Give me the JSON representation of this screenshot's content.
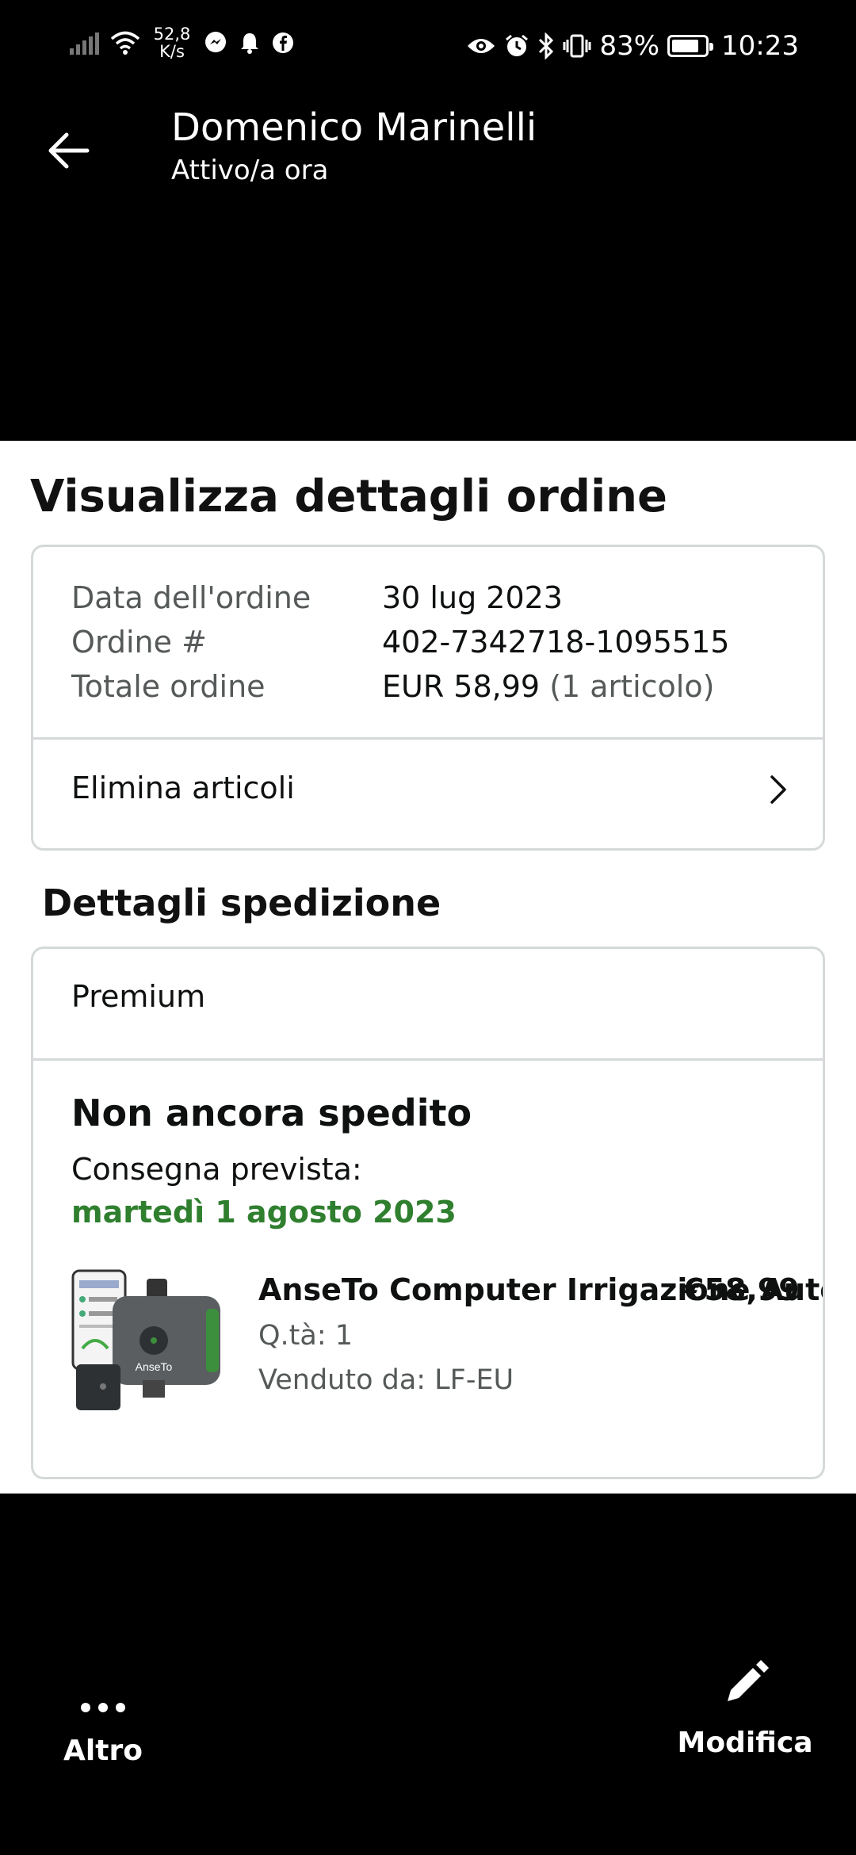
{
  "status_bar": {
    "net_speed": "52,8\nK/s",
    "battery": "83%",
    "battery_level": 0.83,
    "time": "10:23",
    "icons": [
      "signal-icon",
      "wifi-icon",
      "messenger-icon",
      "bell-icon",
      "facebook-icon",
      "eye-icon",
      "alarm-icon",
      "bluetooth-icon",
      "vibrate-icon",
      "battery-icon"
    ]
  },
  "header": {
    "contact_name": "Domenico Marinelli",
    "contact_status": "Attivo/a ora"
  },
  "order": {
    "page_title": "Visualizza dettagli ordine",
    "rows": [
      {
        "label": "Data dell'ordine",
        "value": "30 lug 2023"
      },
      {
        "label": "Ordine #",
        "value": "402-7342718-1095515"
      },
      {
        "label": "Totale ordine",
        "value": "EUR 58,99",
        "extra": "(1 articolo)"
      }
    ],
    "delete_items_label": "Elimina articoli"
  },
  "shipping": {
    "section_title": "Dettagli spedizione",
    "shipping_type": "Premium",
    "status": "Non ancora spedito",
    "delivery_label": "Consegna prevista:",
    "delivery_date": "martedì 1 agosto 2023",
    "delivery_color": "#2f7f2f",
    "product": {
      "name": "AnseTo Computer Irrigazione Automatico",
      "price": "€58,99",
      "quantity": "Q.tà: 1",
      "seller": "Venduto da: LF-EU",
      "image_brand": "AnseTo"
    }
  },
  "bottom_bar": {
    "more_label": "Altro",
    "edit_label": "Modifica"
  }
}
